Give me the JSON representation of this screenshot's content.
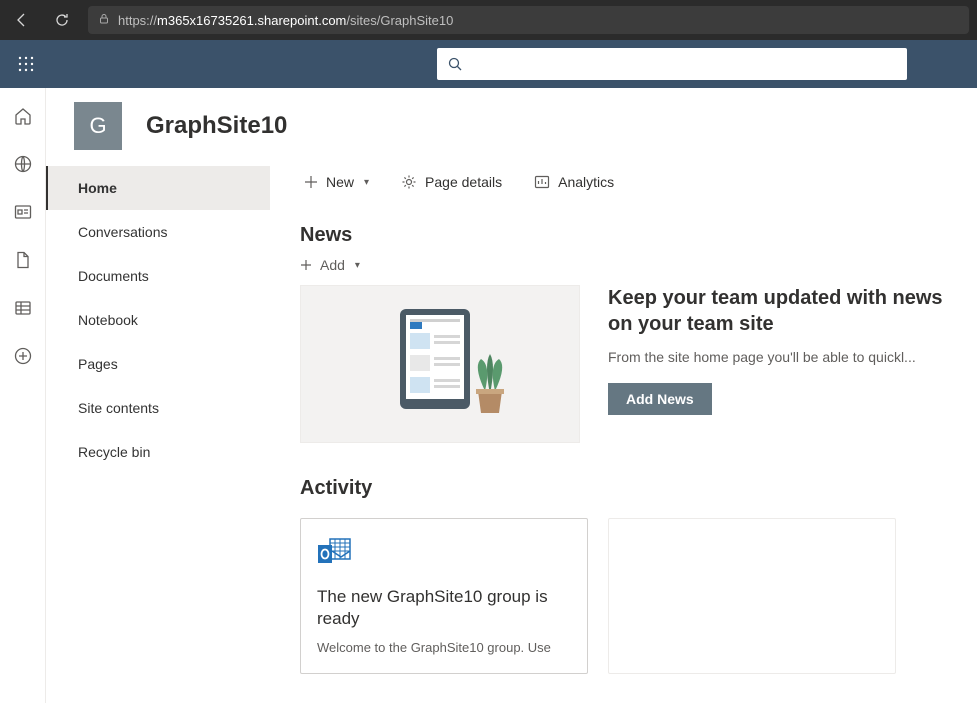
{
  "browser": {
    "url_prefix": "https://",
    "url_host": "m365x16735261.sharepoint.com",
    "url_path": "/sites/GraphSite10"
  },
  "site": {
    "logo_letter": "G",
    "title": "GraphSite10"
  },
  "nav": {
    "items": [
      {
        "label": "Home",
        "selected": true
      },
      {
        "label": "Conversations",
        "selected": false
      },
      {
        "label": "Documents",
        "selected": false
      },
      {
        "label": "Notebook",
        "selected": false
      },
      {
        "label": "Pages",
        "selected": false
      },
      {
        "label": "Site contents",
        "selected": false
      },
      {
        "label": "Recycle bin",
        "selected": false
      }
    ]
  },
  "commands": {
    "new": "New",
    "page_details": "Page details",
    "analytics": "Analytics"
  },
  "news": {
    "section_title": "News",
    "add": "Add",
    "heading": "Keep your team updated with news on your team site",
    "desc": "From the site home page you'll be able to quickl...",
    "button": "Add News"
  },
  "activity": {
    "section_title": "Activity",
    "card1_title": "The new GraphSite10 group is ready",
    "card1_desc": "Welcome to the GraphSite10 group. Use"
  },
  "search": {
    "placeholder": ""
  }
}
